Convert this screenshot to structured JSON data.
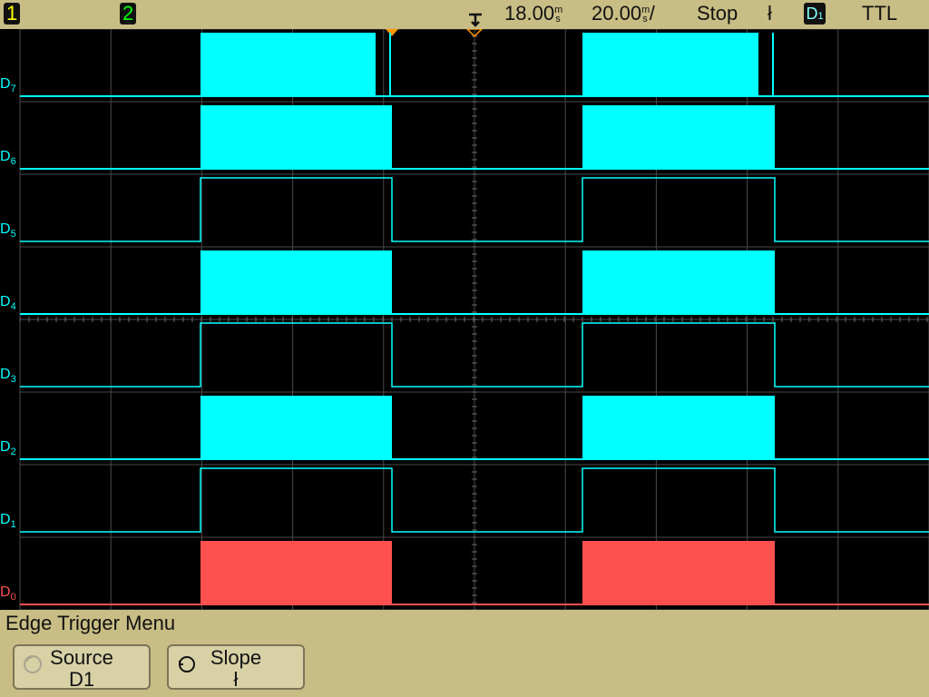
{
  "topbar": {
    "ch1": "1",
    "ch2": "2",
    "time_offset": "18.00",
    "time_unit_sup": "m",
    "time_unit_sub": "s",
    "timebase": "20.00",
    "timebase_unit_sup": "m",
    "timebase_unit_sub": "s",
    "timebase_suffix": "/",
    "run_state": "Stop",
    "slope_symbol": "ł",
    "trigger_source": "D",
    "trigger_source_sub": "1",
    "threshold": "TTL"
  },
  "colors": {
    "topbar_bg": "#c8bd84",
    "digital": "#00ffff",
    "d0": "#ff5050",
    "grid": "#555555",
    "ch1": "#ffff00",
    "ch2": "#00ff00",
    "trigger_marker": "#ff9900"
  },
  "channels": [
    {
      "label": "D",
      "index": "7"
    },
    {
      "label": "D",
      "index": "6"
    },
    {
      "label": "D",
      "index": "5"
    },
    {
      "label": "D",
      "index": "4"
    },
    {
      "label": "D",
      "index": "3"
    },
    {
      "label": "D",
      "index": "2"
    },
    {
      "label": "D",
      "index": "1"
    },
    {
      "label": "D",
      "index": "0"
    }
  ],
  "menu": {
    "title": "Edge Trigger Menu",
    "softkeys": [
      {
        "label": "Source",
        "value": "D1"
      },
      {
        "label": "Slope",
        "value": "ł"
      }
    ]
  }
}
